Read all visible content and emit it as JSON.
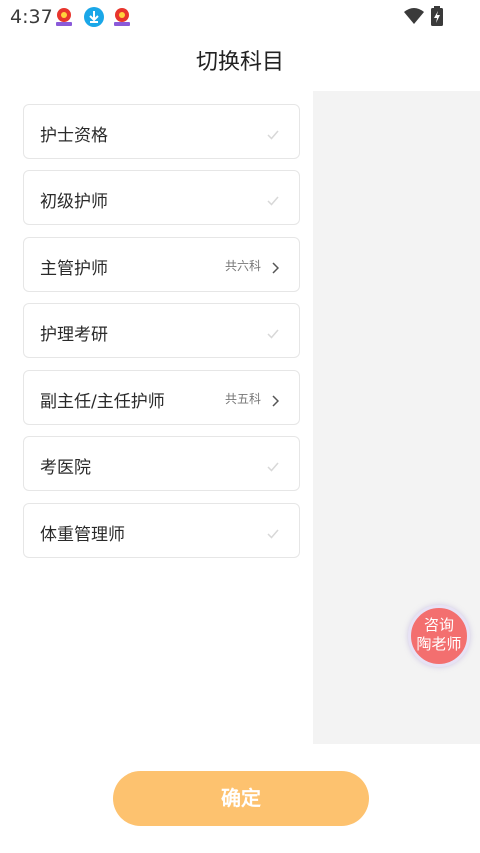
{
  "status_bar": {
    "time": "4:37",
    "notification_icons": [
      "app-logo-icon",
      "download-icon",
      "app-logo-icon"
    ],
    "system_icons": [
      "wifi-icon",
      "battery-charging-icon"
    ]
  },
  "header": {
    "title": "切换科目"
  },
  "subjects": [
    {
      "label": "护士资格",
      "meta": "",
      "indicator": "check-icon"
    },
    {
      "label": "初级护师",
      "meta": "",
      "indicator": "check-icon"
    },
    {
      "label": "主管护师",
      "meta": "共六科",
      "indicator": "chevron-right-icon"
    },
    {
      "label": "护理考研",
      "meta": "",
      "indicator": "check-icon"
    },
    {
      "label": "副主任/主任护师",
      "meta": "共五科",
      "indicator": "chevron-right-icon"
    },
    {
      "label": "考医院",
      "meta": "",
      "indicator": "check-icon"
    },
    {
      "label": "体重管理师",
      "meta": "",
      "indicator": "check-icon"
    }
  ],
  "consult_button": {
    "line1": "咨询",
    "line2": "陶老师"
  },
  "footer": {
    "confirm_label": "确定"
  },
  "colors": {
    "accent_orange": "#fdc26f",
    "consult_red": "#f36f6f",
    "panel_gray": "#f3f3f3"
  }
}
